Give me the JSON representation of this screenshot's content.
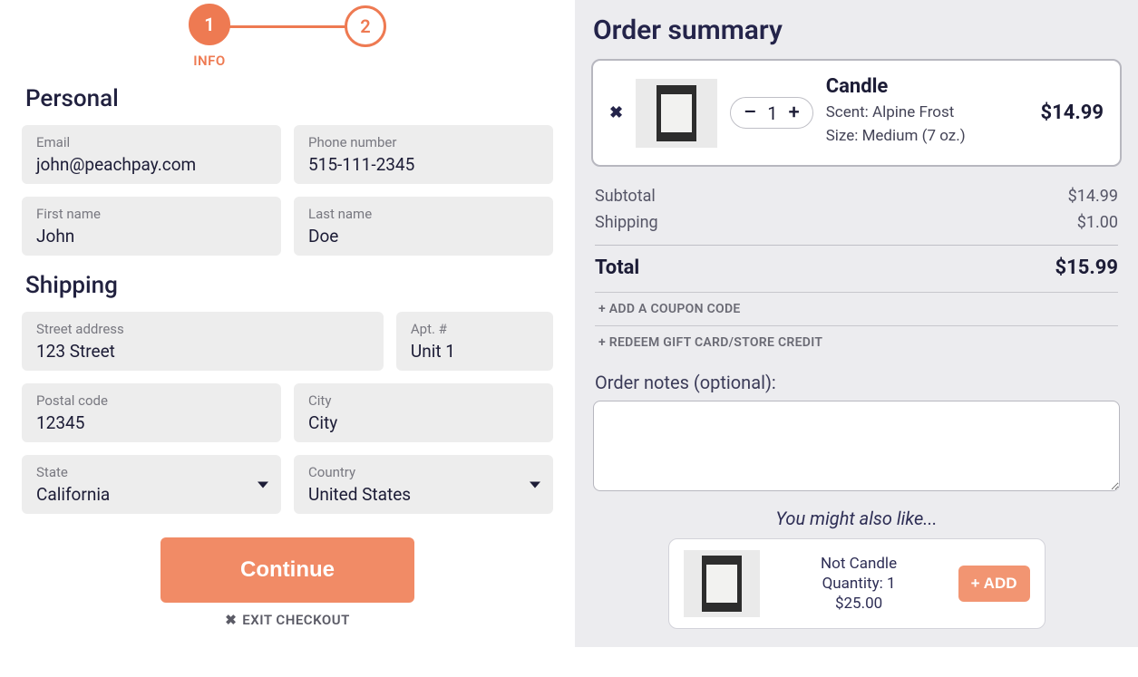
{
  "stepper": {
    "step1_number": "1",
    "step1_label": "INFO",
    "step2_number": "2"
  },
  "sections": {
    "personal_title": "Personal",
    "shipping_title": "Shipping"
  },
  "fields": {
    "email_label": "Email",
    "email_value": "john@peachpay.com",
    "phone_label": "Phone number",
    "phone_value": "515-111-2345",
    "first_label": "First name",
    "first_value": "John",
    "last_label": "Last name",
    "last_value": "Doe",
    "street_label": "Street address",
    "street_value": "123 Street",
    "apt_label": "Apt. #",
    "apt_value": "Unit 1",
    "postal_label": "Postal code",
    "postal_value": "12345",
    "city_label": "City",
    "city_value": "City",
    "state_label": "State",
    "state_value": "California",
    "country_label": "Country",
    "country_value": "United States"
  },
  "actions": {
    "continue_label": "Continue",
    "exit_label": "EXIT CHECKOUT",
    "exit_icon": "✖"
  },
  "summary": {
    "title": "Order summary",
    "item": {
      "name": "Candle",
      "scent_line": "Scent: Alpine Frost",
      "size_line": "Size: Medium (7 oz.)",
      "price": "$14.99",
      "qty": "1",
      "minus": "–",
      "plus": "+",
      "remove": "✖"
    },
    "subtotal_label": "Subtotal",
    "subtotal_value": "$14.99",
    "shipping_label": "Shipping",
    "shipping_value": "$1.00",
    "total_label": "Total",
    "total_value": "$15.99",
    "coupon_label": "+ ADD A COUPON CODE",
    "giftcard_label": "+ REDEEM GIFT CARD/STORE CREDIT",
    "notes_label": "Order notes (optional):"
  },
  "suggest": {
    "title": "You might also like...",
    "name": "Not Candle",
    "qty_line": "Quantity: 1",
    "price": "$25.00",
    "add_label": "+ ADD"
  }
}
